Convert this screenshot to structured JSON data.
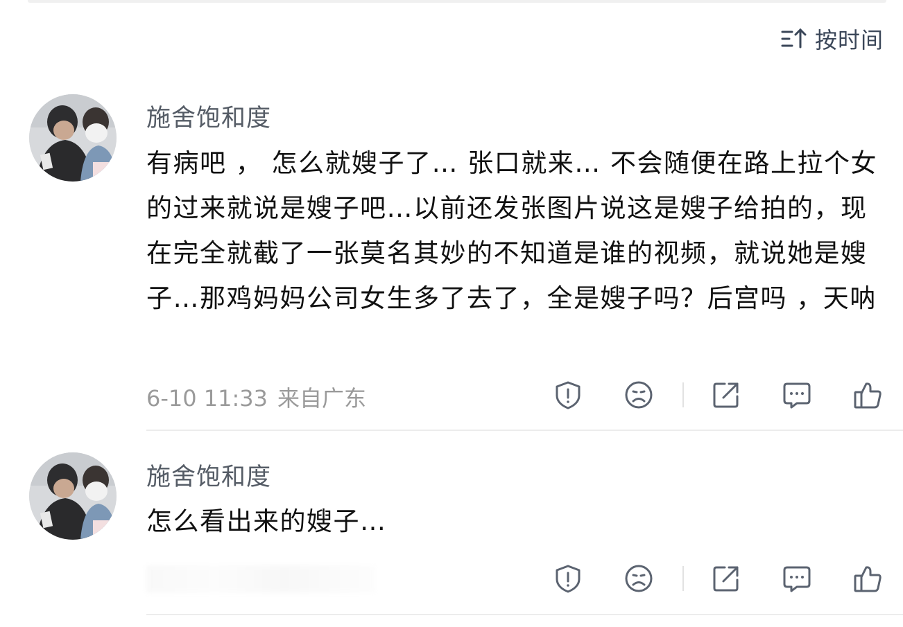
{
  "sort": {
    "label": "按时间",
    "icon": "sort-time-icon"
  },
  "comments": [
    {
      "author": "施舍饱和度",
      "content": "有病吧 ， 怎么就嫂子了… 张口就来… 不会随便在路上拉个女的过来就说是嫂子吧…以前还发张图片说这是嫂子给拍的，现在完全就截了一张莫名其妙的不知道是谁的视频，就说她是嫂子…那鸡妈妈公司女生多了去了，全是嫂子吗？后宫吗 ，天呐",
      "time": "6-10 11:33",
      "location": "来自广东"
    },
    {
      "author": "施舍饱和度",
      "content": "怎么看出来的嫂子…"
    }
  ],
  "actions": [
    "report-icon",
    "dislike-icon",
    "share-icon",
    "reply-icon",
    "like-icon"
  ],
  "colors": {
    "icon": "#5b6370",
    "meta": "#9a9a9a",
    "author": "#555c66"
  }
}
